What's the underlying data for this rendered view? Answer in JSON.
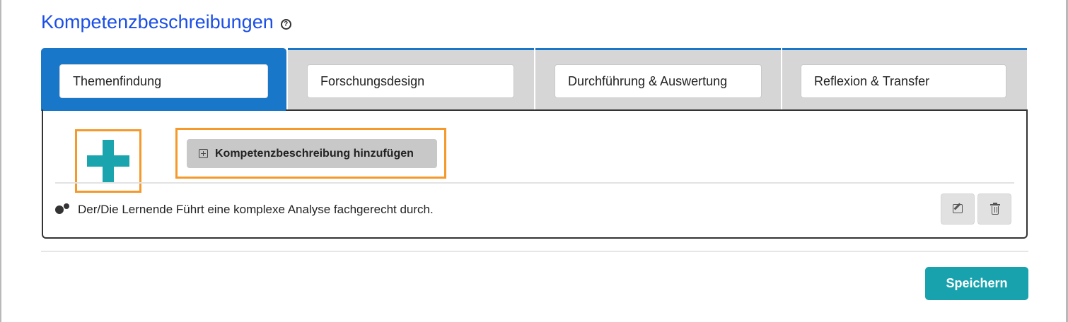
{
  "page": {
    "title": "Kompetenzbeschreibungen",
    "help_icon": "question-circle-icon"
  },
  "tabs": [
    {
      "label": "Themenfindung",
      "active": true
    },
    {
      "label": "Forschungsdesign",
      "active": false
    },
    {
      "label": "Durchführung & Auswertung",
      "active": false
    },
    {
      "label": "Reflexion & Transfer",
      "active": false
    }
  ],
  "panel": {
    "plus_icon": "plus-icon",
    "add_button_label": "Kompetenzbeschreibung hinzufügen",
    "competencies": [
      {
        "icon": "gears-icon",
        "text": "Der/Die Lernende Führt eine komplexe Analyse fachgerecht durch.",
        "actions": [
          "edit-icon",
          "trash-icon"
        ]
      }
    ]
  },
  "footer": {
    "save_label": "Speichern"
  },
  "colors": {
    "heading": "#1a4fe6",
    "tab_active": "#1877c9",
    "tab_inactive": "#d6d6d6",
    "accent_teal": "#17a2ad",
    "highlight_orange": "#f5992a"
  }
}
